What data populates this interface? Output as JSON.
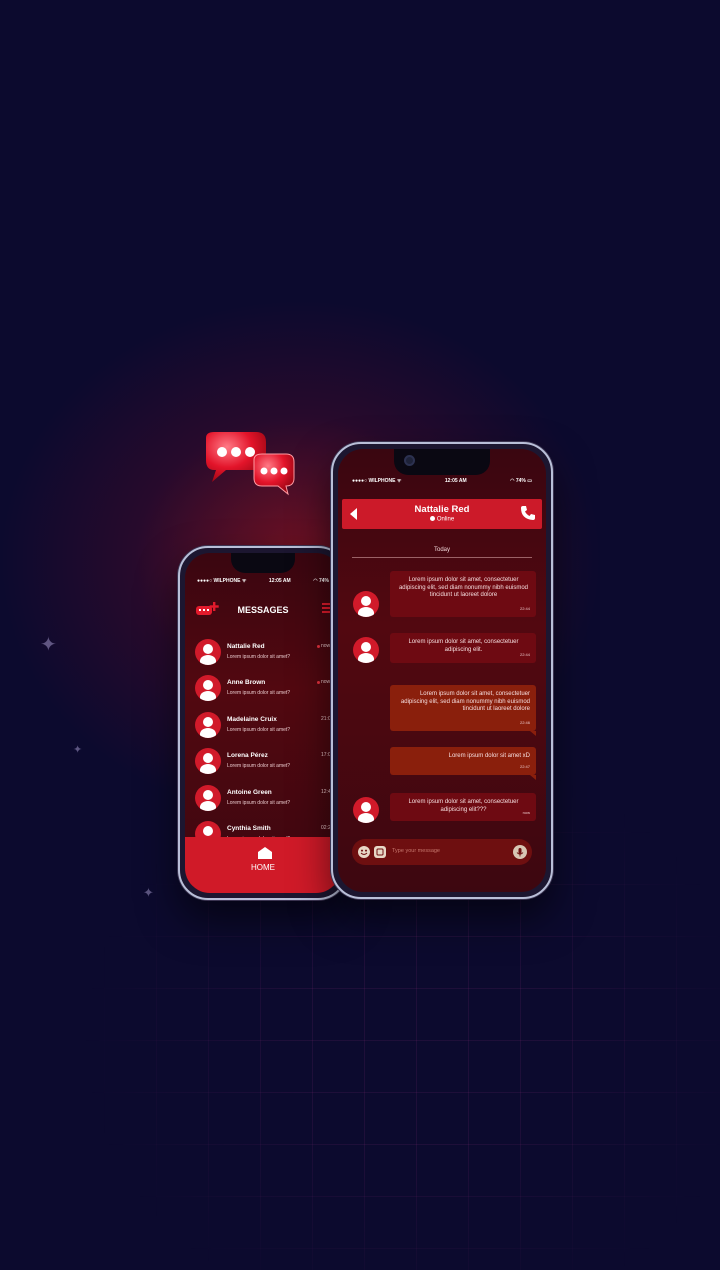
{
  "colors": {
    "background": "#0c0a2e",
    "accent": "#d01a28",
    "screen_dark": "#3a0610",
    "bubble_in": "#6e0a12",
    "bubble_out": "#8a1f0c"
  },
  "left_phone": {
    "status": {
      "carrier": "●●●●○ WILPHONE ᯤ",
      "time": "12:05 AM",
      "battery": "◠ 74%"
    },
    "header": {
      "title": "MESSAGES",
      "compose_icon": "compose-icon",
      "menu_icon": "menu-icon"
    },
    "contacts": [
      {
        "name": "Nattalie Red",
        "preview": "Lorem ipsum dolor sit amet?",
        "time": "now",
        "unread": true
      },
      {
        "name": "Anne Brown",
        "preview": "Lorem ipsum dolor sit amet?",
        "time": "now",
        "unread": true
      },
      {
        "name": "Madelaine Cruix",
        "preview": "Lorem ipsum dolor sit amet?",
        "time": "21:0",
        "unread": false
      },
      {
        "name": "Lorena Pérez",
        "preview": "Lorem ipsum dolor sit amet?",
        "time": "17:0",
        "unread": false
      },
      {
        "name": "Antoine Green",
        "preview": "Lorem ipsum dolor sit amet?",
        "time": "12:4",
        "unread": false
      },
      {
        "name": "Cynthia Smith",
        "preview": "Lorem ipsum dolor sit amet?",
        "time": "02:2",
        "unread": false
      }
    ],
    "home": {
      "label": "HOME",
      "icon": "home-icon"
    }
  },
  "right_phone": {
    "status": {
      "carrier": "●●●●○ WILPHONE ᯤ",
      "time": "12:05 AM",
      "battery": "◠ 74% ▭"
    },
    "header": {
      "name": "Nattalie Red",
      "presence": "Online",
      "back_icon": "back-arrow-icon",
      "call_icon": "phone-icon"
    },
    "day_label": "Today",
    "messages": [
      {
        "direction": "in",
        "text": "Lorem ipsum dolor sit amet, consectetuer adipiscing elit, sed diam nonummy nibh euismod tincidunt ut laoreet dolore",
        "time": "22:44"
      },
      {
        "direction": "in",
        "text": "Lorem ipsum dolor sit amet, consectetuer adipiscing elit.",
        "time": "22:44"
      },
      {
        "direction": "out",
        "text": "Lorem ipsum dolor sit amet, consectetuer adipiscing elit, sed diam nonummy nibh euismod tincidunt ut laoreet dolore",
        "time": "22:46"
      },
      {
        "direction": "out",
        "text": "Lorem ipsum dolor sit amet xD",
        "time": "22:47"
      },
      {
        "direction": "in",
        "text": "Lorem ipsum dolor sit amet, consectetuer adipiscing elit???",
        "time": "now"
      }
    ],
    "input": {
      "placeholder": "Type your message",
      "emoji_icon": "emoji-icon",
      "sticker_icon": "sticker-icon",
      "mic_icon": "microphone-icon"
    }
  }
}
